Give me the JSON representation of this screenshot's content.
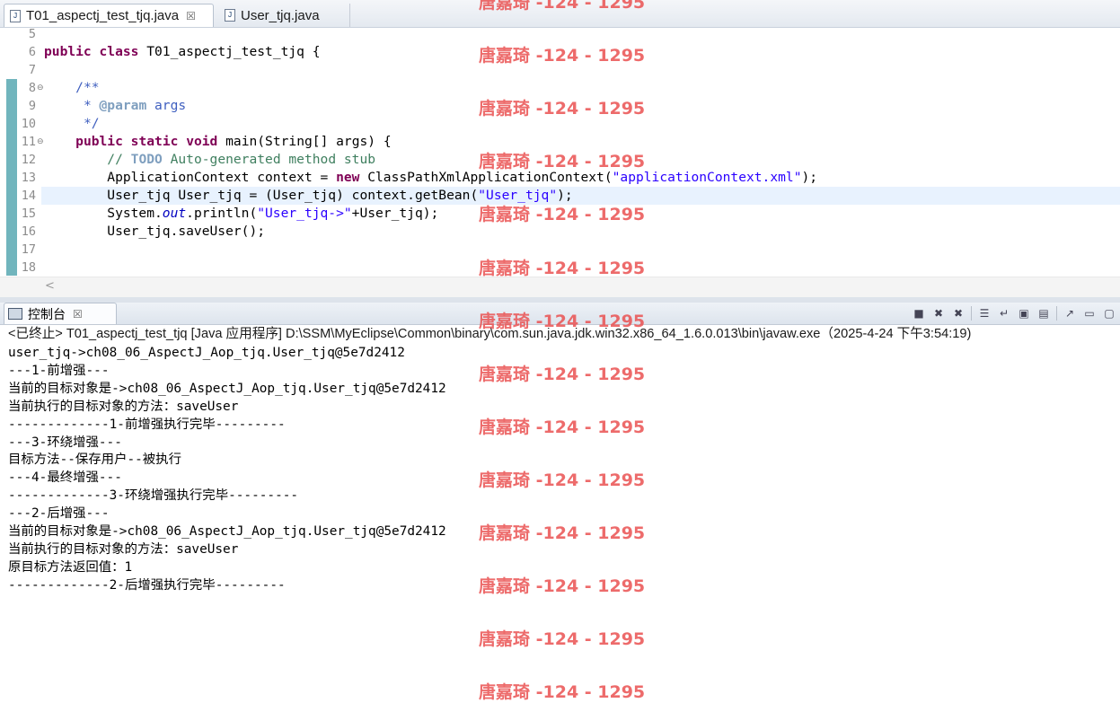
{
  "tabs": [
    {
      "label": "T01_aspectj_test_tjq.java",
      "close": "☒",
      "icon": "J"
    },
    {
      "label": "User_tjq.java",
      "icon": "J"
    }
  ],
  "editor": {
    "lines": [
      {
        "n": "5",
        "fold": "",
        "parts": []
      },
      {
        "n": "6",
        "fold": "",
        "parts": [
          [
            "kw",
            "public"
          ],
          [
            "",
            " "
          ],
          [
            "kw",
            "class"
          ],
          [
            "",
            " T01_aspectj_test_tjq {"
          ]
        ]
      },
      {
        "n": "7",
        "fold": "",
        "parts": []
      },
      {
        "n": "8",
        "fold": "⊖",
        "parts": [
          [
            "",
            "    "
          ],
          [
            "cm",
            "/**"
          ]
        ]
      },
      {
        "n": "9",
        "fold": "",
        "parts": [
          [
            "",
            "     "
          ],
          [
            "cm",
            "* "
          ],
          [
            "tag",
            "@param"
          ],
          [
            "cm",
            " args"
          ]
        ]
      },
      {
        "n": "10",
        "fold": "",
        "parts": [
          [
            "",
            "     "
          ],
          [
            "cm",
            "*/"
          ]
        ]
      },
      {
        "n": "11",
        "fold": "⊖",
        "parts": [
          [
            "",
            "    "
          ],
          [
            "kw",
            "public"
          ],
          [
            "",
            " "
          ],
          [
            "kw",
            "static"
          ],
          [
            "",
            " "
          ],
          [
            "kw",
            "void"
          ],
          [
            "",
            " main(String[] args) {"
          ]
        ]
      },
      {
        "n": "12",
        "fold": "",
        "parts": [
          [
            "",
            "        "
          ],
          [
            "cg",
            "// "
          ],
          [
            "tag",
            "TODO"
          ],
          [
            "cg",
            " Auto-generated method stub"
          ]
        ]
      },
      {
        "n": "13",
        "fold": "",
        "parts": [
          [
            "",
            "        ApplicationContext context = "
          ],
          [
            "kw",
            "new"
          ],
          [
            "",
            " ClassPathXmlApplicationContext("
          ],
          [
            "str",
            "\"applicationContext.xml\""
          ],
          [
            "",
            ");"
          ]
        ]
      },
      {
        "n": "14",
        "fold": "",
        "parts": [
          [
            "",
            "        User_tjq User_tjq = (User_tjq) context.getBean("
          ],
          [
            "str",
            "\"User_tjq\""
          ],
          [
            "",
            ");"
          ]
        ]
      },
      {
        "n": "15",
        "fold": "",
        "parts": [
          [
            "",
            "        System."
          ],
          [
            "it",
            "out"
          ],
          [
            "",
            ".println("
          ],
          [
            "str",
            "\"User_tjq->\""
          ],
          [
            "",
            "+User_tjq);"
          ]
        ]
      },
      {
        "n": "16",
        "fold": "",
        "parts": [
          [
            "",
            "        User_tjq.saveUser();"
          ]
        ]
      },
      {
        "n": "17",
        "fold": "",
        "parts": []
      },
      {
        "n": "18",
        "fold": "",
        "parts": []
      }
    ],
    "scroll_left": "<"
  },
  "console": {
    "tab_label": "控制台",
    "tab_close": "☒",
    "status": "<已终止> T01_aspectj_test_tjq [Java 应用程序] D:\\SSM\\MyEclipse\\Common\\binary\\com.sun.java.jdk.win32.x86_64_1.6.0.013\\bin\\javaw.exe（2025-4-24 下午3:54:19)",
    "output": [
      "user_tjq->ch08_06_AspectJ_Aop_tjq.User_tjq@5e7d2412",
      "---1-前增强---",
      "当前的目标对象是->ch08_06_AspectJ_Aop_tjq.User_tjq@5e7d2412",
      "当前执行的目标对象的方法：saveUser",
      "-------------1-前增强执行完毕---------",
      "---3-环绕增强---",
      "目标方法--保存用户--被执行",
      "---4-最终增强---",
      "-------------3-环绕增强执行完毕---------",
      "---2-后增强---",
      "当前的目标对象是->ch08_06_AspectJ_Aop_tjq.User_tjq@5e7d2412",
      "当前执行的目标对象的方法：saveUser",
      "原目标方法返回值：1",
      "-------------2-后增强执行完毕---------"
    ],
    "toolbar": [
      {
        "name": "terminate-icon",
        "glyph": "■"
      },
      {
        "name": "remove-launch-icon",
        "glyph": "✖"
      },
      {
        "name": "remove-all-icon",
        "glyph": "✖"
      },
      {
        "name": "sep"
      },
      {
        "name": "scroll-lock-icon",
        "glyph": "☰"
      },
      {
        "name": "word-wrap-icon",
        "glyph": "↵"
      },
      {
        "name": "pin-console-icon",
        "glyph": "▣"
      },
      {
        "name": "display-console-icon",
        "glyph": "▤"
      },
      {
        "name": "sep"
      },
      {
        "name": "open-console-icon",
        "glyph": "↗"
      },
      {
        "name": "minimize-icon",
        "glyph": "▭"
      },
      {
        "name": "maximize-icon",
        "glyph": "▢"
      }
    ]
  },
  "watermark": {
    "text": "唐嘉琦 -124 - 1295",
    "count": 14,
    "color": "#ea5252"
  }
}
